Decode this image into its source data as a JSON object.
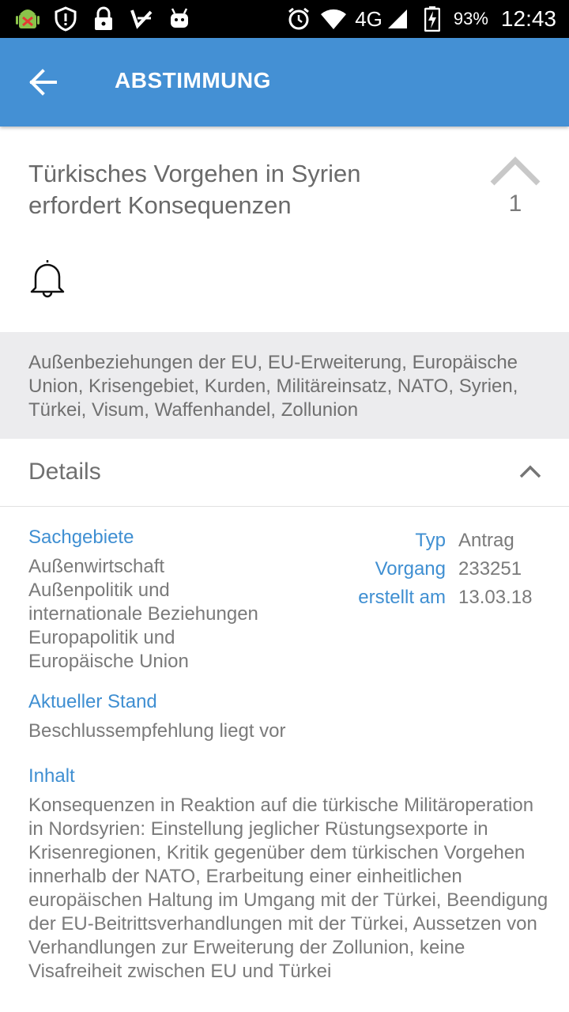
{
  "status_bar": {
    "icons_left": [
      "android-debug-icon",
      "shield-alert-icon",
      "lock-icon",
      "check-flag-icon",
      "android-face-icon"
    ],
    "icons_right": [
      "alarm-icon",
      "wifi-icon",
      "signal-icon",
      "battery-charging-icon"
    ],
    "network": "4G",
    "battery": "93%",
    "time": "12:43"
  },
  "app_bar": {
    "title": "ABSTIMMUNG",
    "back_icon": "arrow-left-icon"
  },
  "item": {
    "title": "Türkisches Vorgehen in Syrien erfordert Konsequenzen",
    "vote_count": "1",
    "vote_icon": "chevron-up-icon",
    "notification_icon": "bell-icon"
  },
  "tags": "Außenbeziehungen der EU, EU-Erweiterung, Europäische Union, Krisengebiet, Kurden, Militäreinsatz, NATO, Syrien, Türkei, Visum, Waffenhandel, Zollunion",
  "details": {
    "header": "Details",
    "sachgebiete_label": "Sachgebiete",
    "sachgebiete": [
      "Außenwirtschaft",
      "Außenpolitik und",
      "internationale Beziehungen",
      "Europapolitik und",
      "Europäische Union"
    ],
    "meta": [
      {
        "key": "Typ",
        "value": "Antrag"
      },
      {
        "key": "Vorgang",
        "value": "233251"
      },
      {
        "key": "erstellt am",
        "value": "13.03.18"
      }
    ],
    "stand_label": "Aktueller Stand",
    "stand_value": "Beschlussempfehlung liegt vor",
    "inhalt_label": "Inhalt",
    "inhalt_value": "Konsequenzen in Reaktion auf die türkische Militäroperation in Nordsyrien: Einstellung jeglicher Rüstungsexporte in Krisenregionen, Kritik gegenüber dem türkischen Vorgehen innerhalb der NATO, Erarbeitung einer einheitlichen europäischen Haltung im Umgang mit der Türkei, Beendigung der EU-Beitrittsverhandlungen mit der Türkei, Aussetzen von Verhandlungen zur Erweiterung der Zollunion, keine Visafreiheit zwischen EU und Türkei"
  },
  "colors": {
    "app_bar": "#4490d4",
    "accent": "#3f8fd2",
    "tags_bg": "#ececee",
    "status_bar": "#000000"
  }
}
